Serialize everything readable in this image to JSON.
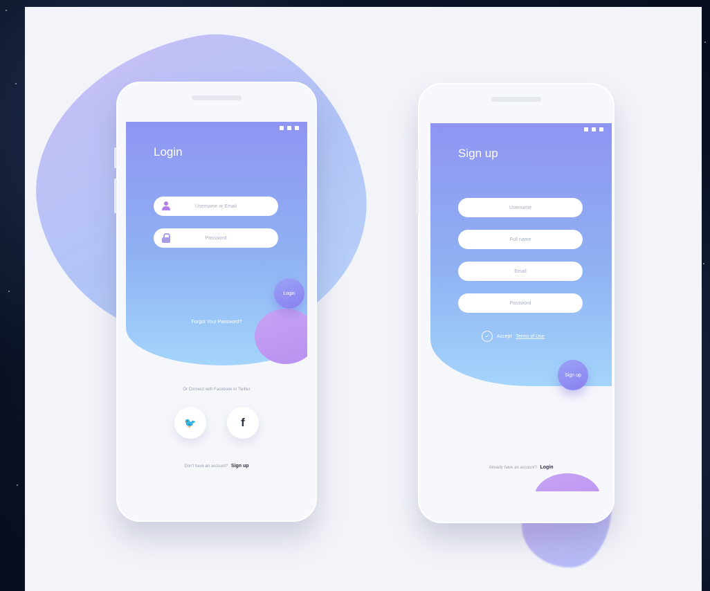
{
  "login_screen": {
    "title": "Login",
    "username_placeholder": "Username or Email",
    "password_placeholder": "Password",
    "login_button": "Login",
    "forgot_password": "Forgot Your Password?",
    "social_caption": "Or Connect with Facebook or Twitter",
    "social": [
      {
        "name": "twitter",
        "glyph": "🐦"
      },
      {
        "name": "facebook",
        "glyph": "f"
      }
    ],
    "footer_text": "Don't have an account?",
    "footer_link": "Sign up"
  },
  "signup_screen": {
    "title": "Sign up",
    "fields": [
      "Username",
      "Full name",
      "Email",
      "Password"
    ],
    "accept_prefix": "Accept",
    "accept_link": "Terms of Use",
    "signup_button": "Sign up",
    "footer_text": "Already have an account?",
    "footer_link": "Login"
  },
  "colors": {
    "gradient_top": "#8f95f2",
    "gradient_bottom": "#a4d5fb",
    "accent_purple": "#b990f0",
    "twitter_blue": "#1da1f2",
    "facebook_dark": "#2c2f3f"
  },
  "icons": {
    "user": "user-icon",
    "lock": "lock-icon",
    "check": "check-circle-icon"
  }
}
